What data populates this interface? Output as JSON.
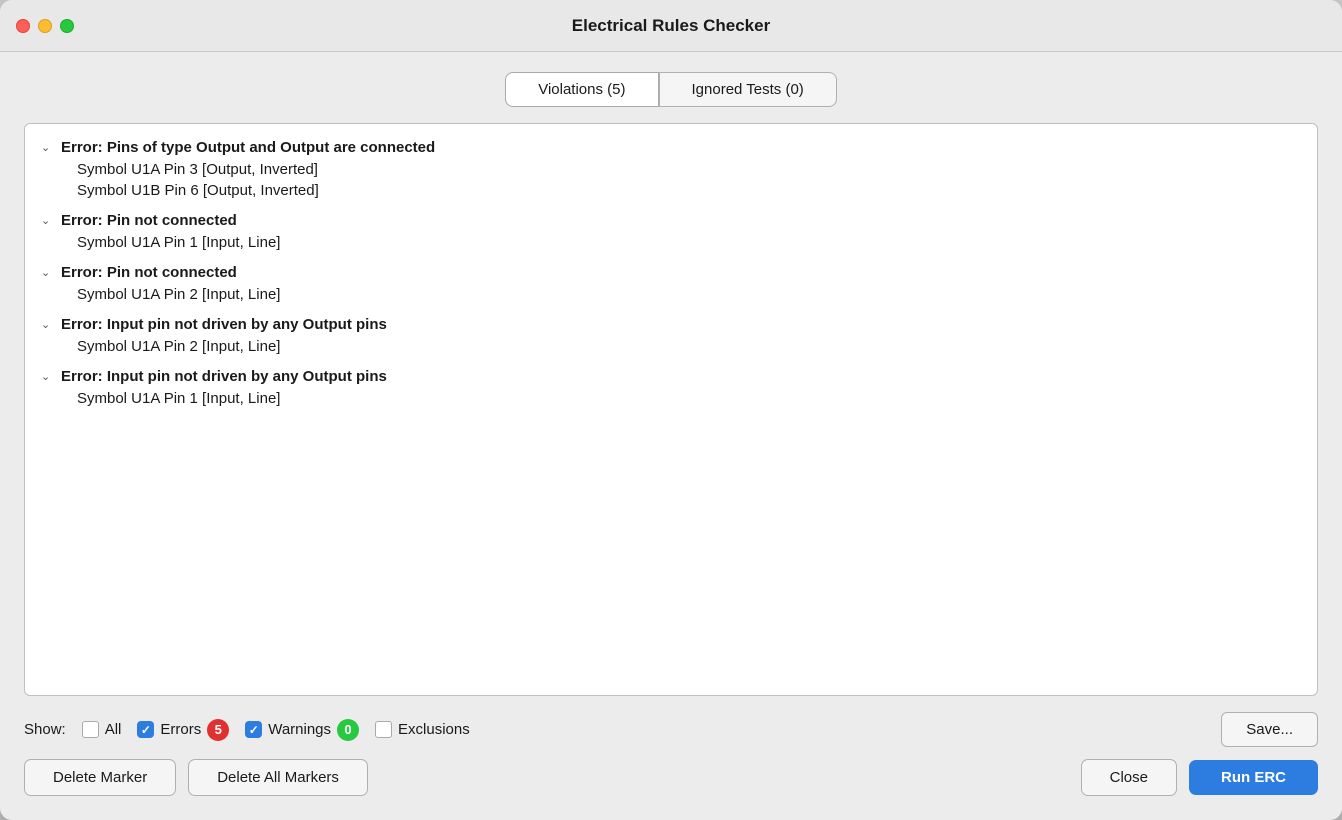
{
  "window": {
    "title": "Electrical Rules Checker"
  },
  "tabs": [
    {
      "id": "violations",
      "label": "Violations (5)",
      "active": true
    },
    {
      "id": "ignored",
      "label": "Ignored Tests (0)",
      "active": false
    }
  ],
  "violations": [
    {
      "id": "v1",
      "title": "Error: Pins of type Output and Output are connected",
      "children": [
        "Symbol U1A Pin 3 [Output, Inverted]",
        "Symbol U1B Pin 6 [Output, Inverted]"
      ]
    },
    {
      "id": "v2",
      "title": "Error: Pin not connected",
      "children": [
        "Symbol U1A Pin 1 [Input, Line]"
      ]
    },
    {
      "id": "v3",
      "title": "Error: Pin not connected",
      "children": [
        "Symbol U1A Pin 2 [Input, Line]"
      ]
    },
    {
      "id": "v4",
      "title": "Error: Input pin not driven by any Output pins",
      "children": [
        "Symbol U1A Pin 2 [Input, Line]"
      ]
    },
    {
      "id": "v5",
      "title": "Error: Input pin not driven by any Output pins",
      "children": [
        "Symbol U1A Pin 1 [Input, Line]"
      ]
    }
  ],
  "filters": {
    "show_label": "Show:",
    "all_label": "All",
    "errors_label": "Errors",
    "errors_count": "5",
    "warnings_label": "Warnings",
    "warnings_count": "0",
    "exclusions_label": "Exclusions"
  },
  "buttons": {
    "save": "Save...",
    "delete_marker": "Delete Marker",
    "delete_all_markers": "Delete All Markers",
    "close": "Close",
    "run_erc": "Run ERC"
  }
}
